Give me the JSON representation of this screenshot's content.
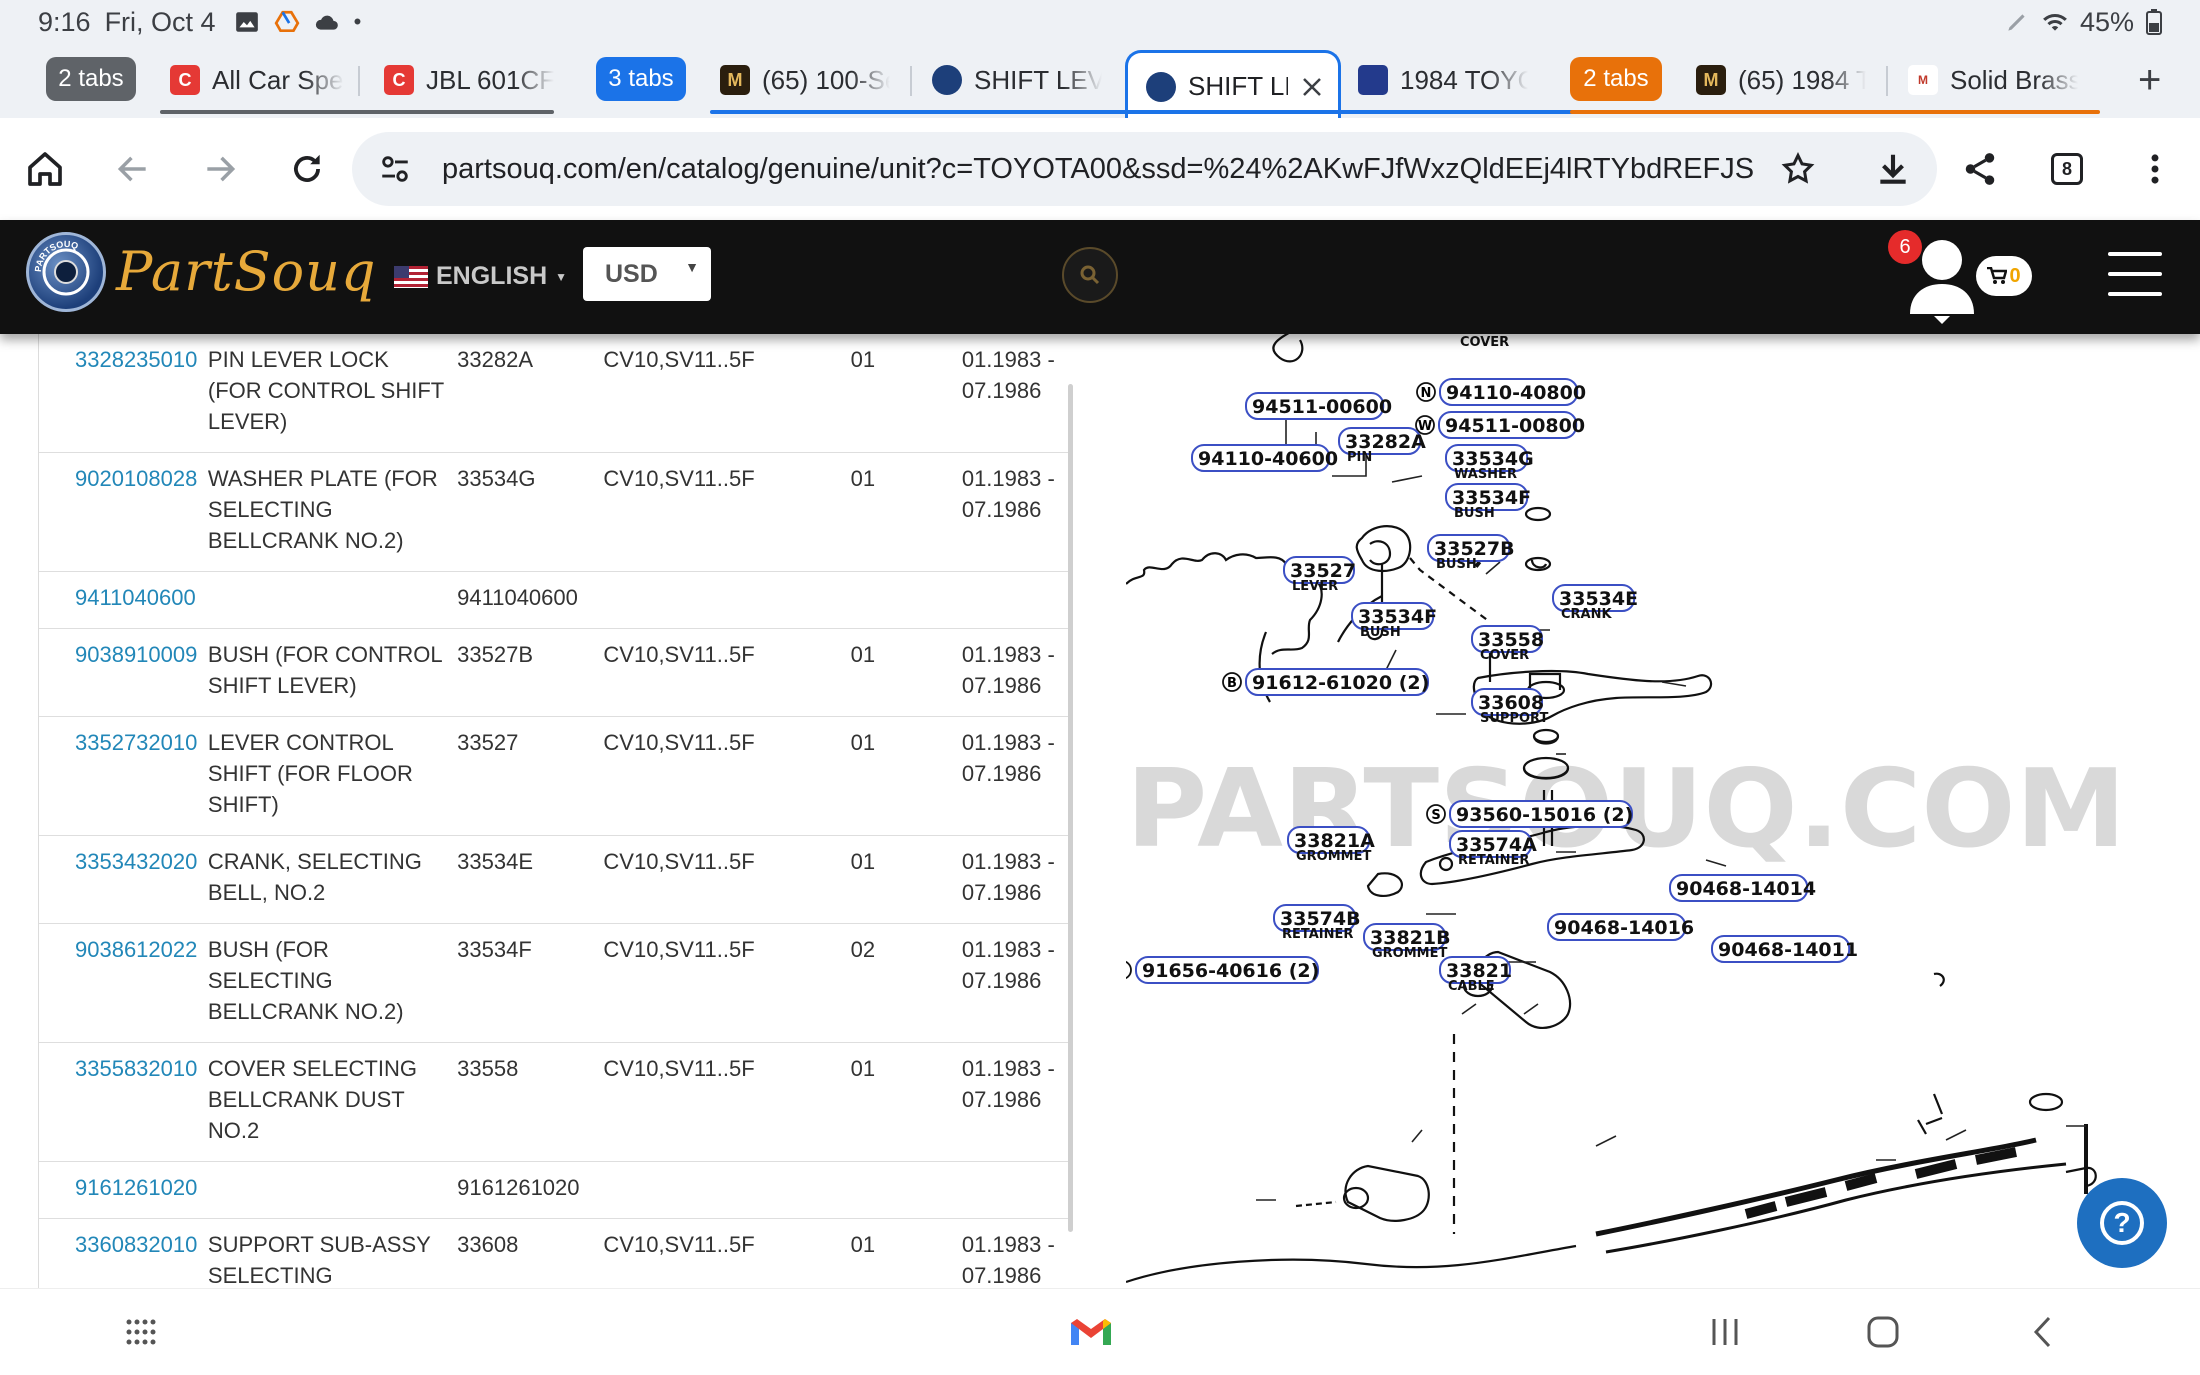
{
  "status_bar": {
    "time": "9:16",
    "date": "Fri, Oct 4",
    "battery": "45%",
    "icons": [
      "gallery-icon",
      "drive-icon",
      "cloud-icon",
      "dot-icon",
      "pen-icon",
      "wifi-icon",
      "battery-icon"
    ]
  },
  "tabs": {
    "groups": [
      {
        "label": "2 tabs",
        "color": "#5f6368"
      },
      {
        "label": "3 tabs",
        "color": "#1b73e8"
      },
      {
        "label": "2 tabs",
        "color": "#e8710a"
      }
    ],
    "items": [
      {
        "title": "All Car Spe",
        "favicon": "C"
      },
      {
        "title": "JBL 601CF",
        "favicon": "C"
      },
      {
        "title": "(65) 100-Se",
        "favicon": "M"
      },
      {
        "title": "SHIFT LEVE",
        "favicon": "partsouq"
      },
      {
        "title": "SHIFT LE",
        "favicon": "partsouq",
        "active": true
      },
      {
        "title": "1984 TOYO",
        "favicon": "toyota"
      },
      {
        "title": "(65) 1984 To",
        "favicon": "M"
      },
      {
        "title": "Solid Brass",
        "favicon": "brass"
      }
    ],
    "tab_count": "8"
  },
  "toolbar": {
    "url": "partsouq.com/en/catalog/genuine/unit?c=TOYOTA00&ssd=%24%2AKwFJfWxzQldEEj4lRTYbdREFJS"
  },
  "site_header": {
    "logo_text": "PartSouq",
    "logo_badge": "PARTSOUQ",
    "language": "ENGLISH",
    "currency": "USD",
    "notification_count": "6",
    "cart_count": "0"
  },
  "parts": [
    {
      "number": "3328235010",
      "name": "PIN LEVER LOCK (FOR CONTROL SHIFT LEVER)",
      "code": "33282A",
      "model": "CV10,SV11..5F",
      "qty": "01",
      "date": "01.1983 - 07.1986"
    },
    {
      "number": "9020108028",
      "name": "WASHER PLATE (FOR SELECTING BELLCRANK NO.2)",
      "code": "33534G",
      "model": "CV10,SV11..5F",
      "qty": "01",
      "date": "01.1983 - 07.1986"
    },
    {
      "number": "9411040600",
      "name": "",
      "code": "9411040600",
      "model": "",
      "qty": "",
      "date": ""
    },
    {
      "number": "9038910009",
      "name": "BUSH (FOR CONTROL SHIFT LEVER)",
      "code": "33527B",
      "model": "CV10,SV11..5F",
      "qty": "01",
      "date": "01.1983 - 07.1986"
    },
    {
      "number": "3352732010",
      "name": "LEVER CONTROL SHIFT (FOR FLOOR SHIFT)",
      "code": "33527",
      "model": "CV10,SV11..5F",
      "qty": "01",
      "date": "01.1983 - 07.1986"
    },
    {
      "number": "3353432020",
      "name": "CRANK, SELECTING BELL, NO.2",
      "code": "33534E",
      "model": "CV10,SV11..5F",
      "qty": "01",
      "date": "01.1983 - 07.1986"
    },
    {
      "number": "9038612022",
      "name": "BUSH (FOR SELECTING BELLCRANK NO.2)",
      "code": "33534F",
      "model": "CV10,SV11..5F",
      "qty": "02",
      "date": "01.1983 - 07.1986"
    },
    {
      "number": "3355832010",
      "name": "COVER SELECTING BELLCRANK DUST NO.2",
      "code": "33558",
      "model": "CV10,SV11..5F",
      "qty": "01",
      "date": "01.1983 - 07.1986"
    },
    {
      "number": "9161261020",
      "name": "",
      "code": "9161261020",
      "model": "",
      "qty": "",
      "date": ""
    },
    {
      "number": "3360832010",
      "name": "SUPPORT SUB-ASSY SELECTING BELLCRANK",
      "code": "33608",
      "model": "CV10,SV11..5F",
      "qty": "01",
      "date": "01.1983 - 07.1986"
    }
  ],
  "diagram": {
    "watermark": "PARTSOUQ.COM",
    "callouts": [
      {
        "code": "94110-40800",
        "sub": "",
        "symbol": "N"
      },
      {
        "code": "94511-00600",
        "sub": "",
        "symbol": ""
      },
      {
        "code": "94511-00800",
        "sub": "",
        "symbol": "W"
      },
      {
        "code": "33282A",
        "sub": "PIN",
        "symbol": ""
      },
      {
        "code": "94110-40600",
        "sub": "",
        "symbol": ""
      },
      {
        "code": "33534G",
        "sub": "WASHER",
        "symbol": ""
      },
      {
        "code": "33534F",
        "sub": "BUSH",
        "symbol": ""
      },
      {
        "code": "33527B",
        "sub": "BUSH",
        "symbol": ""
      },
      {
        "code": "33527",
        "sub": "LEVER",
        "symbol": ""
      },
      {
        "code": "33534E",
        "sub": "CRANK",
        "symbol": ""
      },
      {
        "code": "33534F",
        "sub": "BUSH",
        "symbol": ""
      },
      {
        "code": "33558",
        "sub": "COVER",
        "symbol": ""
      },
      {
        "code": "91612-61020 (2)",
        "sub": "",
        "symbol": "B"
      },
      {
        "code": "33608",
        "sub": "SUPPORT",
        "symbol": ""
      },
      {
        "code": "93560-15016 (2)",
        "sub": "",
        "symbol": "S"
      },
      {
        "code": "33821A",
        "sub": "GROMMET",
        "symbol": ""
      },
      {
        "code": "33574A",
        "sub": "RETAINER",
        "symbol": ""
      },
      {
        "code": "90468-14014",
        "sub": "",
        "symbol": ""
      },
      {
        "code": "33574B",
        "sub": "RETAINER",
        "symbol": ""
      },
      {
        "code": "90468-14016",
        "sub": "",
        "symbol": ""
      },
      {
        "code": "33821B",
        "sub": "GROMMET",
        "symbol": ""
      },
      {
        "code": "90468-14011",
        "sub": "",
        "symbol": ""
      },
      {
        "code": "91656-40616 (2)",
        "sub": "",
        "symbol": "B"
      },
      {
        "code": "33821",
        "sub": "CABLE",
        "symbol": ""
      },
      {
        "code": "",
        "sub": "COVER",
        "symbol": ""
      }
    ]
  },
  "nav_bar": {
    "icons": [
      "apps-grid-icon",
      "gmail-icon",
      "recents-icon",
      "home-circle-icon",
      "back-chevron-icon"
    ]
  }
}
